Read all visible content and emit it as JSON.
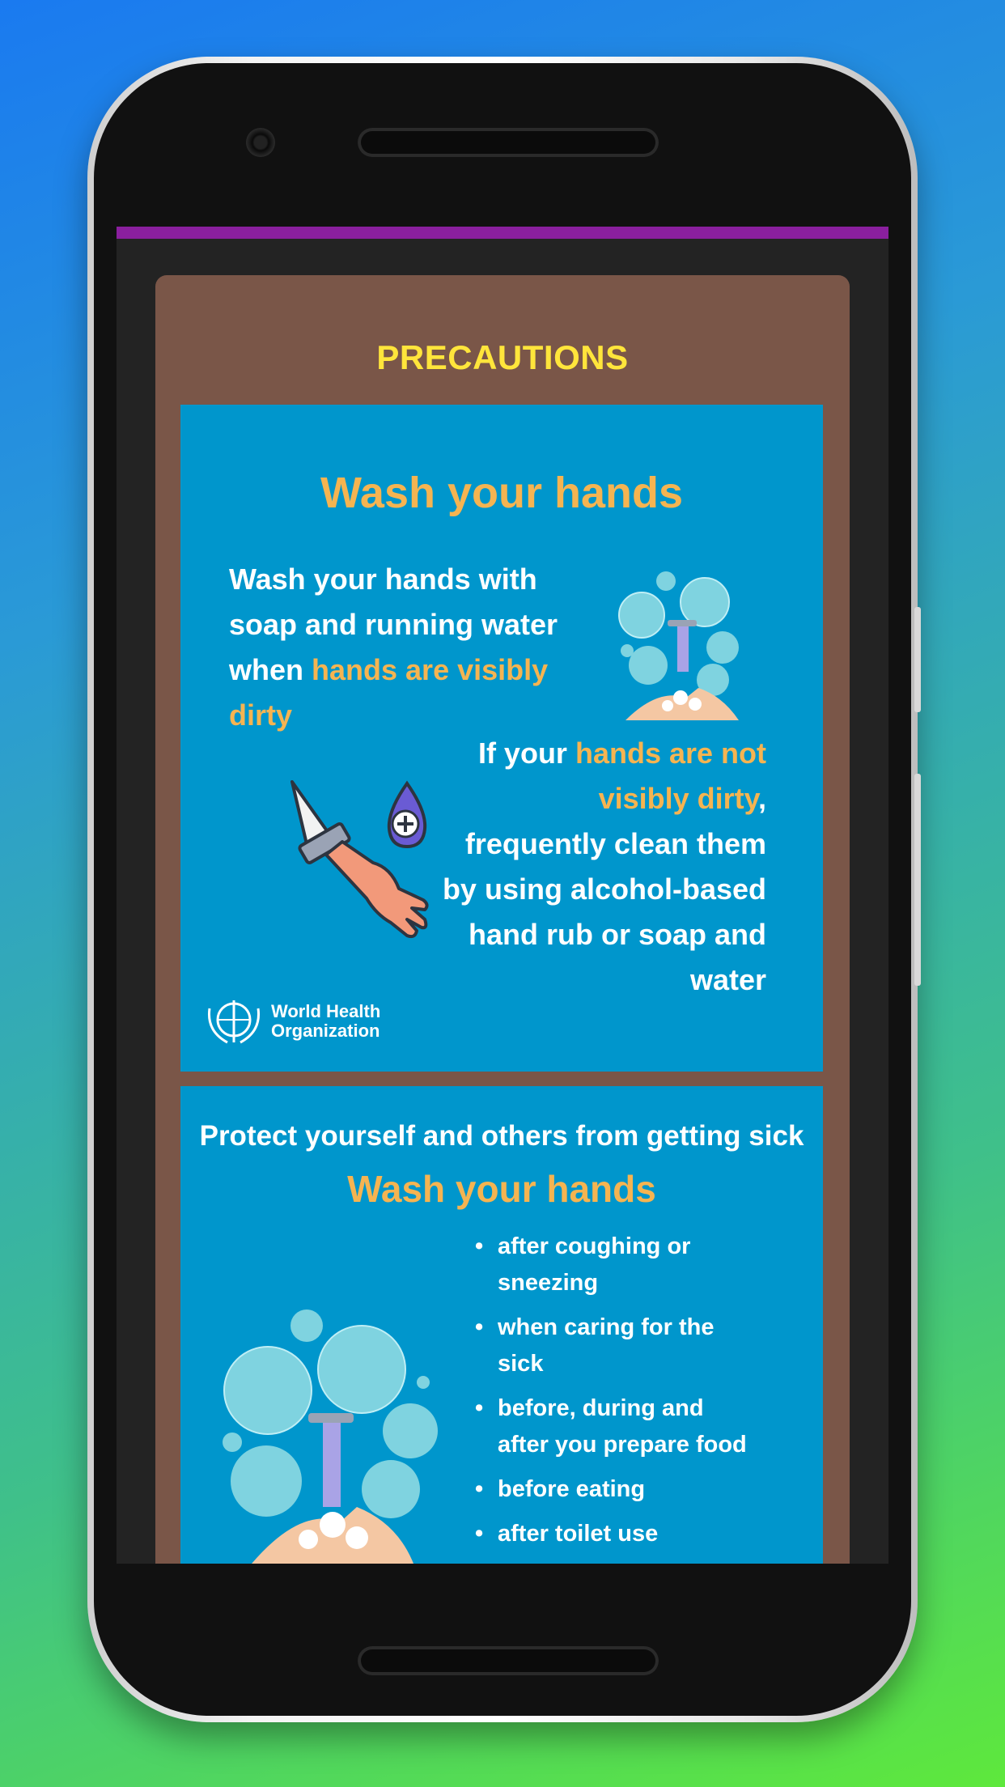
{
  "screen": {
    "title": "PRECAUTIONS",
    "status_bar_color": "#8a1f9e"
  },
  "panel1": {
    "heading": "Wash your hands",
    "text1_a": "Wash your hands with",
    "text1_b": "soap and running water",
    "text1_c": "when ",
    "text1_hl1": "hands are visibly",
    "text1_hl2": "dirty",
    "text2_a": "If your ",
    "text2_hl1": "hands are not",
    "text2_hl2": "visibly dirty",
    "text2_comma": ",",
    "text2_b": "frequently clean them",
    "text2_c": "by using alcohol-based",
    "text2_d": "hand rub or soap and",
    "text2_e": "water",
    "org_line1": "World Health",
    "org_line2": "Organization"
  },
  "panel2": {
    "subtitle": "Protect yourself and others from getting sick",
    "heading": "Wash your hands",
    "bullets": [
      [
        "after coughing or",
        "sneezing"
      ],
      [
        "when caring for the",
        "sick"
      ],
      [
        "before, during and",
        "after you prepare food"
      ],
      [
        "before eating",
        ""
      ],
      [
        "after toilet use",
        ""
      ]
    ]
  },
  "colors": {
    "panel_bg": "#0096cc",
    "card_bg": "#7a5648",
    "title": "#ffe53b",
    "highlight": "#f5b451"
  },
  "icons": [
    "bubbles-hands-icon",
    "sanitizer-hand-icon",
    "who-emblem-icon",
    "camera-icon",
    "speaker-icon"
  ]
}
